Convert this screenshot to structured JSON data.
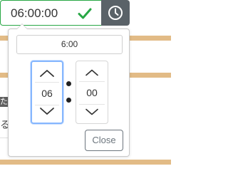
{
  "time_input": {
    "value": "06:00:00",
    "valid_icon": "check-icon",
    "button_icon": "clock-icon"
  },
  "picker": {
    "display": "6:00",
    "hours": {
      "value": "06",
      "up_icon": "chevron-up-icon",
      "down_icon": "chevron-down-icon"
    },
    "minutes": {
      "value": "00",
      "up_icon": "chevron-up-icon",
      "down_icon": "chevron-down-icon"
    },
    "separator_icon": "colon-icon",
    "close_label": "Close"
  },
  "background": {
    "dark_label": "た",
    "fragment": "る"
  },
  "colors": {
    "valid_green": "#28a745",
    "button_gray": "#5a6268",
    "focus_blue": "#86b7fe",
    "accent_tan": "#e2bb86"
  }
}
